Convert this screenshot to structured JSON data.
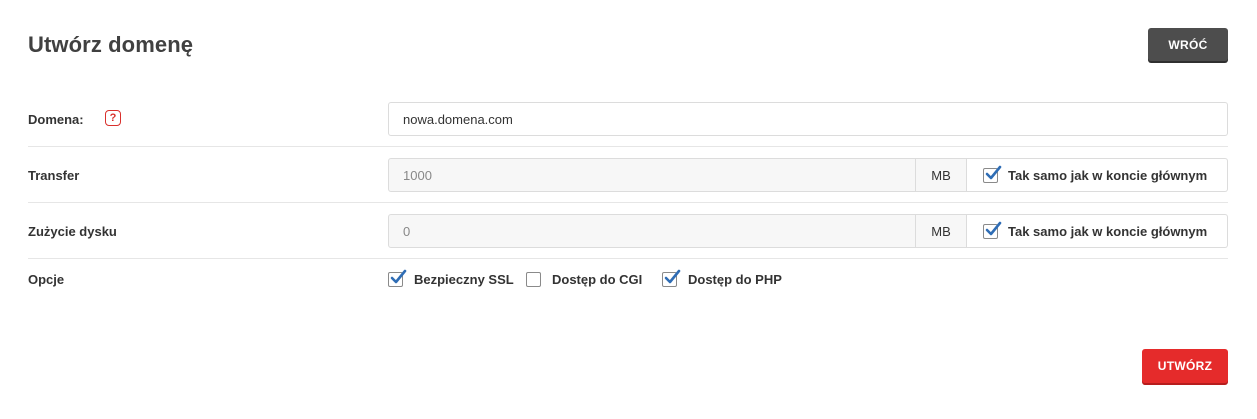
{
  "header": {
    "title": "Utwórz domenę",
    "back_label": "WRÓĆ"
  },
  "form": {
    "domain": {
      "label": "Domena:",
      "help": "?",
      "value": "nowa.domena.com"
    },
    "transfer": {
      "label": "Transfer",
      "value": "1000",
      "unit": "MB",
      "same_label": "Tak samo jak w koncie głównym",
      "same_checked": true
    },
    "disk": {
      "label": "Zużycie dysku",
      "value": "0",
      "unit": "MB",
      "same_label": "Tak samo jak w koncie głównym",
      "same_checked": true
    },
    "options": {
      "label": "Opcje",
      "items": [
        {
          "label": "Bezpieczny SSL",
          "checked": true
        },
        {
          "label": "Dostęp do CGI",
          "checked": false
        },
        {
          "label": "Dostęp do PHP",
          "checked": true
        }
      ]
    }
  },
  "footer": {
    "create_label": "UTWÓRZ"
  },
  "colors": {
    "accent_red": "#e52b2b",
    "back_button": "#4d4d4d",
    "check_blue": "#2f6db5"
  }
}
